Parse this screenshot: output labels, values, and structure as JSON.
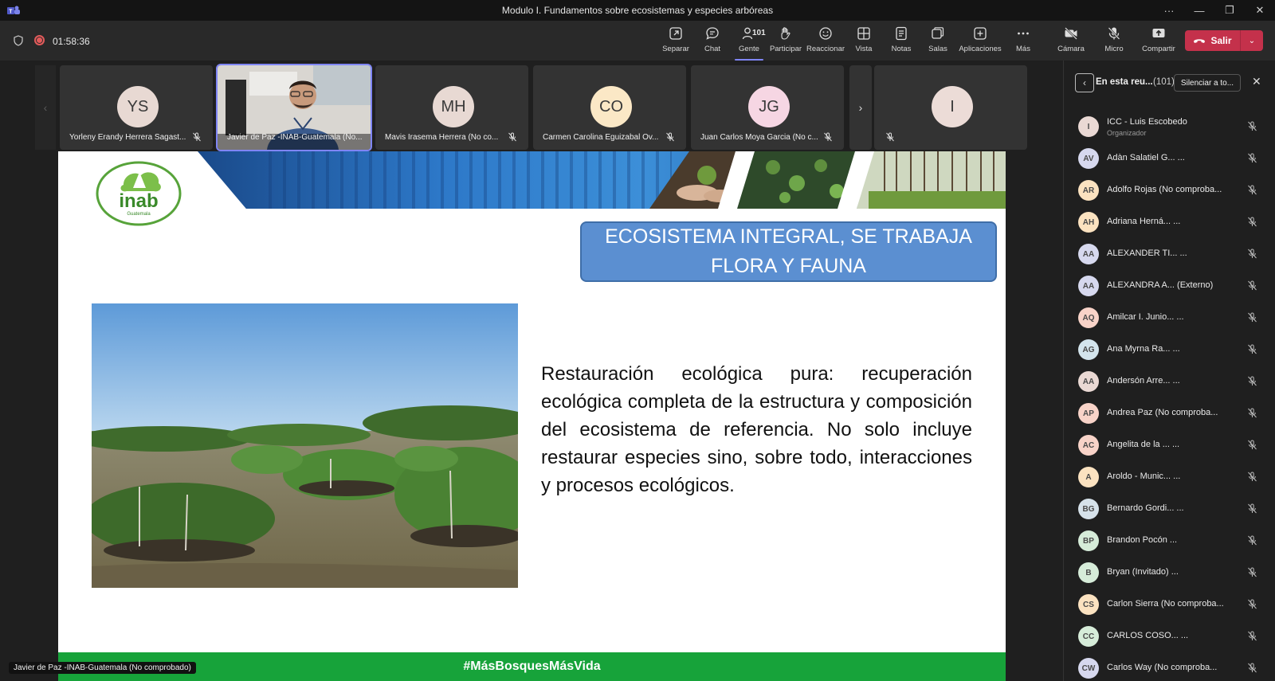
{
  "window": {
    "title": "Modulo I. Fundamentos sobre ecosistemas y especies arbóreas",
    "more": "···",
    "minimize": "—",
    "restore": "❐",
    "close": "✕"
  },
  "toolbar": {
    "timer": "01:58:36",
    "items": [
      {
        "label": "Separar",
        "icon": "pop-out-icon"
      },
      {
        "label": "Chat",
        "icon": "chat-icon"
      },
      {
        "label": "Gente",
        "icon": "people-icon",
        "count": "101",
        "active": true
      },
      {
        "label": "Participar",
        "icon": "raise-hand-icon"
      },
      {
        "label": "Reaccionar",
        "icon": "react-icon"
      },
      {
        "label": "Vista",
        "icon": "view-icon"
      },
      {
        "label": "Notas",
        "icon": "notes-icon"
      },
      {
        "label": "Salas",
        "icon": "rooms-icon"
      },
      {
        "label": "Aplicaciones",
        "icon": "apps-icon"
      },
      {
        "label": "Más",
        "icon": "more-icon"
      },
      {
        "label": "Cámara",
        "icon": "camera-off-icon"
      },
      {
        "label": "Micro",
        "icon": "mic-off-icon"
      },
      {
        "label": "Compartir",
        "icon": "share-icon"
      }
    ],
    "leave_label": "Salir",
    "leave_color": "#c4314b"
  },
  "tiles": [
    {
      "initials": "YS",
      "name": "Yorleny Erandy Herrera Sagast...",
      "color": "#e8d9d3"
    },
    {
      "initials": "",
      "name": "Javier de Paz -INAB-Guatemala (No...",
      "video": true
    },
    {
      "initials": "MH",
      "name": "Mavis Irasema Herrera (No co...",
      "color": "#e8d9d3"
    },
    {
      "initials": "CO",
      "name": "Carmen Carolina Eguizabal Ov...",
      "color": "#fbe8c6"
    },
    {
      "initials": "JG",
      "name": "Juan Carlos Moya Garcia (No c...",
      "color": "#f6d6e3"
    },
    {
      "initials": "I",
      "name": "",
      "color": "#ecdcd7"
    }
  ],
  "slide": {
    "title": "ECOSISTEMA INTEGRAL, SE TRABAJA FLORA Y FAUNA",
    "body": "Restauración ecológica pura: recuperación ecológica completa de la estructura y composición del ecosistema de referencia. No solo incluye restaurar especies sino, sobre todo, interacciones y procesos ecológicos.",
    "footer": "#MásBosquesMásVida",
    "logo_text": "inab",
    "logo_sub": "Guatemala",
    "title_color": "#5b8fd1",
    "footer_color": "#17a33a"
  },
  "speaker_label": "Javier de Paz -INAB-Guatemala (No comprobado)",
  "panel": {
    "title": "En esta reu...",
    "count": "(101)",
    "mute_all": "Silenciar a to...",
    "people": [
      {
        "initials": "I",
        "name": "ICC - Luis Escobedo",
        "sub": "Organizador",
        "color": "#ead9d4"
      },
      {
        "initials": "AV",
        "name": "Adàn Salatiel G... ...",
        "color": "#d6d8ee"
      },
      {
        "initials": "AR",
        "name": "Adolfo Rojas (No comproba...",
        "color": "#fbe2c0"
      },
      {
        "initials": "AH",
        "name": "Adriana Herná... ...",
        "color": "#fbe2c0"
      },
      {
        "initials": "AA",
        "name": "ALEXANDER TI... ...",
        "color": "#d6d8ee"
      },
      {
        "initials": "AA",
        "name": "ALEXANDRA A... (Externo)",
        "color": "#d6d8ee"
      },
      {
        "initials": "AQ",
        "name": "Amilcar I. Junio... ...",
        "color": "#f8d3c8"
      },
      {
        "initials": "AG",
        "name": "Ana Myrna Ra... ...",
        "color": "#d3e4ec"
      },
      {
        "initials": "AA",
        "name": "Andersón Arre... ...",
        "color": "#ead9d4"
      },
      {
        "initials": "AP",
        "name": "Andrea Paz (No comproba...",
        "color": "#f8d3c8"
      },
      {
        "initials": "AC",
        "name": "Angelita de la ... ...",
        "color": "#f8d3c8"
      },
      {
        "initials": "A",
        "name": "Aroldo - Munic... ...",
        "color": "#fbe2c0"
      },
      {
        "initials": "BG",
        "name": "Bernardo Gordi... ...",
        "color": "#d6e2ea"
      },
      {
        "initials": "BP",
        "name": "Brandon Pocón ...",
        "color": "#d6ecd9"
      },
      {
        "initials": "B",
        "name": "Bryan (Invitado) ...",
        "color": "#d6ecd9"
      },
      {
        "initials": "CS",
        "name": "Carlon Sierra (No comproba...",
        "color": "#fbe2c0"
      },
      {
        "initials": "CC",
        "name": "CARLOS COSO... ...",
        "color": "#d6ecd9"
      },
      {
        "initials": "CW",
        "name": "Carlos Way (No comproba...",
        "color": "#d6d8ee"
      }
    ]
  }
}
